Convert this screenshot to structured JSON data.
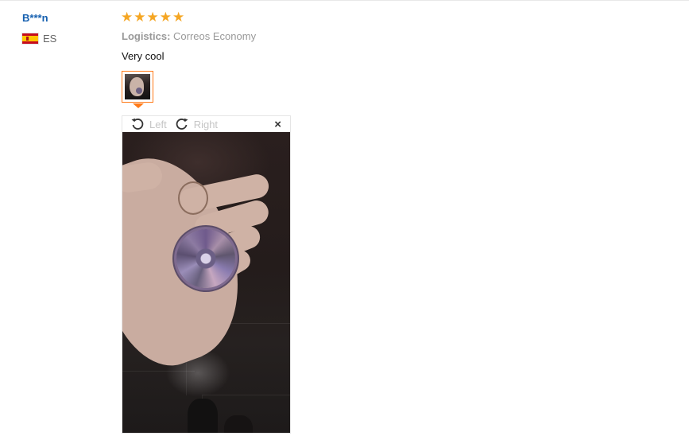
{
  "review": {
    "user_name": "B***n",
    "country_code": "ES",
    "rating": 5,
    "stars": [
      "★",
      "★",
      "★",
      "★",
      "★"
    ],
    "logistics_label": "Logistics:",
    "logistics_value": "Correos Economy",
    "text": "Very cool"
  },
  "viewer": {
    "rotate_left_label": "Left",
    "rotate_right_label": "Right",
    "close_label": "×"
  },
  "colors": {
    "accent": "#ff7a18",
    "star": "#f5a623",
    "user_link": "#1660b0"
  },
  "icons": {
    "flag": "spain-flag-icon",
    "rotate_left": "rotate-left-icon",
    "rotate_right": "rotate-right-icon",
    "close": "close-icon"
  }
}
